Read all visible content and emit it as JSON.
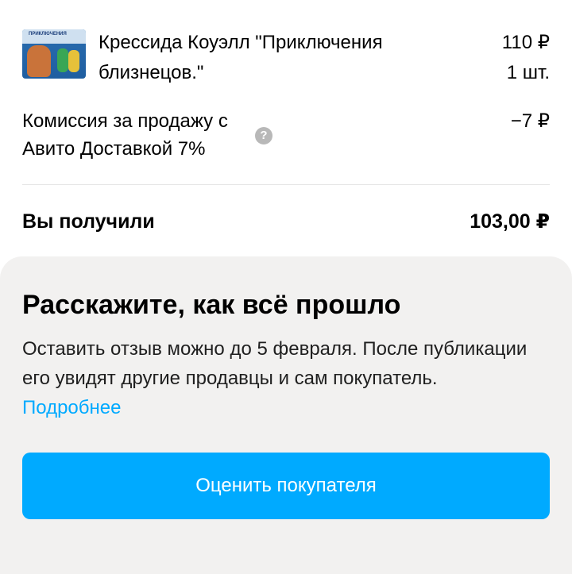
{
  "order": {
    "item": {
      "title": "Крессида Коуэлл \"Приключения близнецов.\"",
      "price": "110 ₽",
      "quantity": "1 шт.",
      "thumbnail_title": "ПРИКЛЮЧЕНИЯ"
    },
    "fee": {
      "label": "Комиссия за продажу с Авито Доставкой 7%",
      "amount": "−7 ₽",
      "help_icon": "question-circle-icon"
    },
    "total": {
      "label": "Вы получили",
      "amount": "103,00 ₽"
    }
  },
  "review": {
    "title": "Расскажите, как всё прошло",
    "text": "Оставить отзыв можно до 5 февраля. После публикации его увидят другие продавцы и сам покупатель.",
    "link_label": "Подробнее",
    "button_label": "Оценить покупателя"
  },
  "colors": {
    "accent": "#00aaff",
    "card_background": "#f2f1f0",
    "help_icon": "#b8b8b8"
  }
}
